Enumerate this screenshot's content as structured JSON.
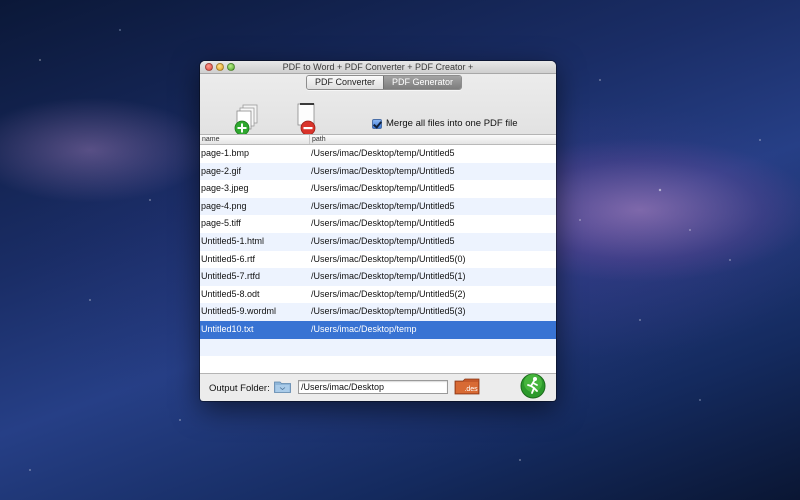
{
  "window": {
    "title": "PDF to Word + PDF Converter + PDF Creator +"
  },
  "tabs": [
    {
      "label": "PDF Converter",
      "active": false
    },
    {
      "label": "PDF Generator",
      "active": true
    }
  ],
  "toolbar": {
    "add_icon": "add-files-icon",
    "remove_icon": "remove-files-icon",
    "merge_checked": true,
    "merge_label": "Merge all files into one PDF file"
  },
  "table": {
    "columns": [
      "name",
      "path"
    ],
    "rows": [
      {
        "name": "page-1.bmp",
        "path": "/Users/imac/Desktop/temp/Untitled5"
      },
      {
        "name": "page-2.gif",
        "path": "/Users/imac/Desktop/temp/Untitled5"
      },
      {
        "name": "page-3.jpeg",
        "path": "/Users/imac/Desktop/temp/Untitled5"
      },
      {
        "name": "page-4.png",
        "path": "/Users/imac/Desktop/temp/Untitled5"
      },
      {
        "name": "page-5.tiff",
        "path": "/Users/imac/Desktop/temp/Untitled5"
      },
      {
        "name": "Untitled5-1.html",
        "path": "/Users/imac/Desktop/temp/Untitled5"
      },
      {
        "name": "Untitled5-6.rtf",
        "path": "/Users/imac/Desktop/temp/Untitled5(0)"
      },
      {
        "name": "Untitled5-7.rtfd",
        "path": "/Users/imac/Desktop/temp/Untitled5(1)"
      },
      {
        "name": "Untitled5-8.odt",
        "path": "/Users/imac/Desktop/temp/Untitled5(2)"
      },
      {
        "name": "Untitled5-9.wordml",
        "path": "/Users/imac/Desktop/temp/Untitled5(3)"
      },
      {
        "name": "Untitled10.txt",
        "path": "/Users/imac/Desktop/temp",
        "selected": true
      }
    ]
  },
  "footer": {
    "output_label": "Output Folder:",
    "output_path": "/Users/imac/Desktop",
    "des_label": ".des",
    "folder_icon": "folder-icon",
    "start_icon": "run-convert-icon"
  },
  "colors": {
    "selection": "#3873d3",
    "stripe": "#edf3fe",
    "accent_green": "#2fa82f",
    "remove_red": "#d9342b"
  }
}
